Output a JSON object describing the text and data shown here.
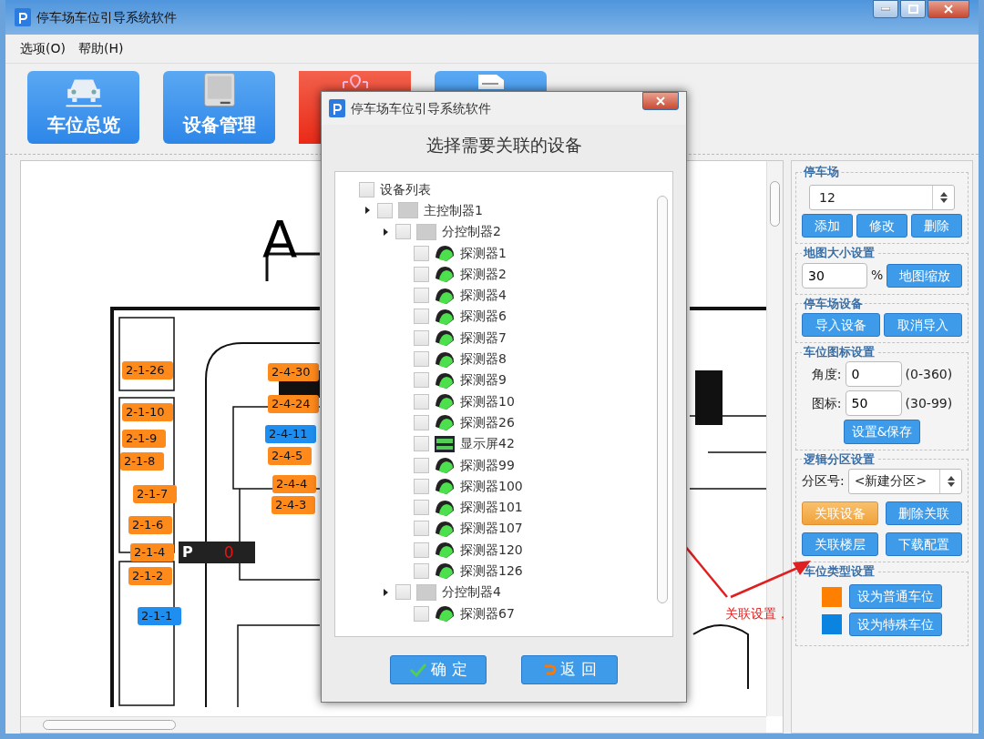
{
  "window": {
    "title": "停车场车位引导系统软件"
  },
  "menu": [
    "选项(O)",
    "帮助(H)"
  ],
  "toolbar": [
    {
      "kind": "car",
      "label": "车位总览",
      "selected": false
    },
    {
      "kind": "device",
      "label": "设备管理",
      "selected": false
    },
    {
      "kind": "map",
      "selected": true
    },
    {
      "kind": "document",
      "selected": false
    }
  ],
  "map": {
    "title": "A",
    "sign": {
      "letter": "P",
      "count": "0"
    },
    "spots": [
      {
        "label": "2-1-26",
        "color": "#ff8a1c"
      },
      {
        "label": "2-1-10",
        "color": "#ff8a1c"
      },
      {
        "label": "2-1-9",
        "color": "#ff8a1c"
      },
      {
        "label": "2-1-8",
        "color": "#ff8a1c"
      },
      {
        "label": "2-1-7",
        "color": "#ff8a1c"
      },
      {
        "label": "2-1-6",
        "color": "#ff8a1c"
      },
      {
        "label": "2-1-4",
        "color": "#ff8a1c"
      },
      {
        "label": "2-1-2",
        "color": "#ff8a1c"
      },
      {
        "label": "2-1-1",
        "color": "#1e8ff0"
      },
      {
        "label": "2-4-30",
        "color": "#ff8a1c"
      },
      {
        "label": "2-4-24",
        "color": "#ff8a1c"
      },
      {
        "label": "2-4-11",
        "color": "#1e8ff0"
      },
      {
        "label": "2-4-5",
        "color": "#ff8a1c"
      },
      {
        "label": "2-4-4",
        "color": "#ff8a1c"
      },
      {
        "label": "2-4-3",
        "color": "#ff8a1c"
      }
    ]
  },
  "annotation": {
    "text": "关联设置，"
  },
  "parking_lot": {
    "legend": "停车场",
    "value": "12",
    "buttons": [
      "添加",
      "修改",
      "删除"
    ]
  },
  "map_size": {
    "legend": "地图大小设置",
    "value": "30",
    "unit": "%",
    "button": "地图缩放"
  },
  "lot_devices": {
    "legend": "停车场设备",
    "buttons": [
      "导入设备",
      "取消导入"
    ]
  },
  "icon_settings": {
    "legend": "车位图标设置",
    "fields": [
      {
        "label": "角度:",
        "value": "0",
        "range": "(0-360)"
      },
      {
        "label": "图标:",
        "value": "50",
        "range": "(30-99)"
      }
    ],
    "button": "设置&保存"
  },
  "zones": {
    "legend": "逻辑分区设置",
    "label": "分区号:",
    "value": "<新建分区>",
    "buttons": [
      {
        "label": "关联设备",
        "highlighted": true
      },
      {
        "label": "删除关联",
        "highlighted": false
      },
      {
        "label": "关联楼层",
        "highlighted": false
      },
      {
        "label": "下载配置",
        "highlighted": false
      }
    ]
  },
  "spot_types": {
    "legend": "车位类型设置",
    "items": [
      {
        "color": "#ff8000",
        "button": "设为普通车位"
      },
      {
        "color": "#0a84e0",
        "button": "设为特殊车位"
      }
    ]
  },
  "dialog": {
    "title": "停车场车位引导系统软件",
    "heading": "选择需要关联的设备",
    "tree": [
      {
        "label": "设备列表",
        "checked": false,
        "children": [
          {
            "kind": "controller",
            "label": "主控制器1",
            "checked": false,
            "children": [
              {
                "kind": "controller",
                "label": "分控制器2",
                "checked": false,
                "children": [
                  {
                    "kind": "detector",
                    "label": "探测器1",
                    "checked": false
                  },
                  {
                    "kind": "detector",
                    "label": "探测器2",
                    "checked": false
                  },
                  {
                    "kind": "detector",
                    "label": "探测器4",
                    "checked": false
                  },
                  {
                    "kind": "detector",
                    "label": "探测器6",
                    "checked": false
                  },
                  {
                    "kind": "detector",
                    "label": "探测器7",
                    "checked": false
                  },
                  {
                    "kind": "detector",
                    "label": "探测器8",
                    "checked": false
                  },
                  {
                    "kind": "detector",
                    "label": "探测器9",
                    "checked": false
                  },
                  {
                    "kind": "detector",
                    "label": "探测器10",
                    "checked": false
                  },
                  {
                    "kind": "detector",
                    "label": "探测器26",
                    "checked": false
                  },
                  {
                    "kind": "display",
                    "label": "显示屏42",
                    "checked": false
                  },
                  {
                    "kind": "detector",
                    "label": "探测器99",
                    "checked": false
                  },
                  {
                    "kind": "detector",
                    "label": "探测器100",
                    "checked": false
                  },
                  {
                    "kind": "detector",
                    "label": "探测器101",
                    "checked": false
                  },
                  {
                    "kind": "detector",
                    "label": "探测器107",
                    "checked": false
                  },
                  {
                    "kind": "detector",
                    "label": "探测器120",
                    "checked": false
                  },
                  {
                    "kind": "detector",
                    "label": "探测器126",
                    "checked": false
                  }
                ]
              },
              {
                "kind": "controller",
                "label": "分控制器4",
                "checked": false,
                "children": [
                  {
                    "kind": "detector",
                    "label": "探测器67",
                    "checked": false
                  }
                ]
              }
            ]
          }
        ]
      }
    ],
    "buttons": [
      {
        "kind": "ok",
        "label": "确 定"
      },
      {
        "kind": "back",
        "label": "返 回"
      }
    ]
  }
}
